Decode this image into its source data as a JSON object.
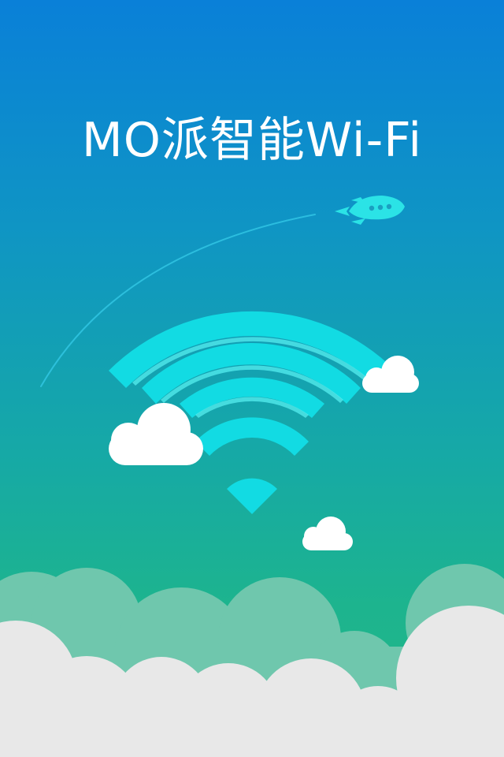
{
  "splash": {
    "title": "MO派智能Wi-Fi"
  },
  "colors": {
    "gradient_top": "#0a80d8",
    "gradient_bottom": "#22b888",
    "wifi_arc": "#12dbe3",
    "wifi_arc_highlight": "#5af4f4",
    "rocket": "#2be3e6",
    "cloud": "#ffffff",
    "cloud_back": "#6fc7ad",
    "cloud_front": "#e8e8e8"
  },
  "icons": {
    "wifi": "wifi-signal-icon",
    "rocket": "rocket-icon",
    "cloud": "cloud-icon"
  }
}
